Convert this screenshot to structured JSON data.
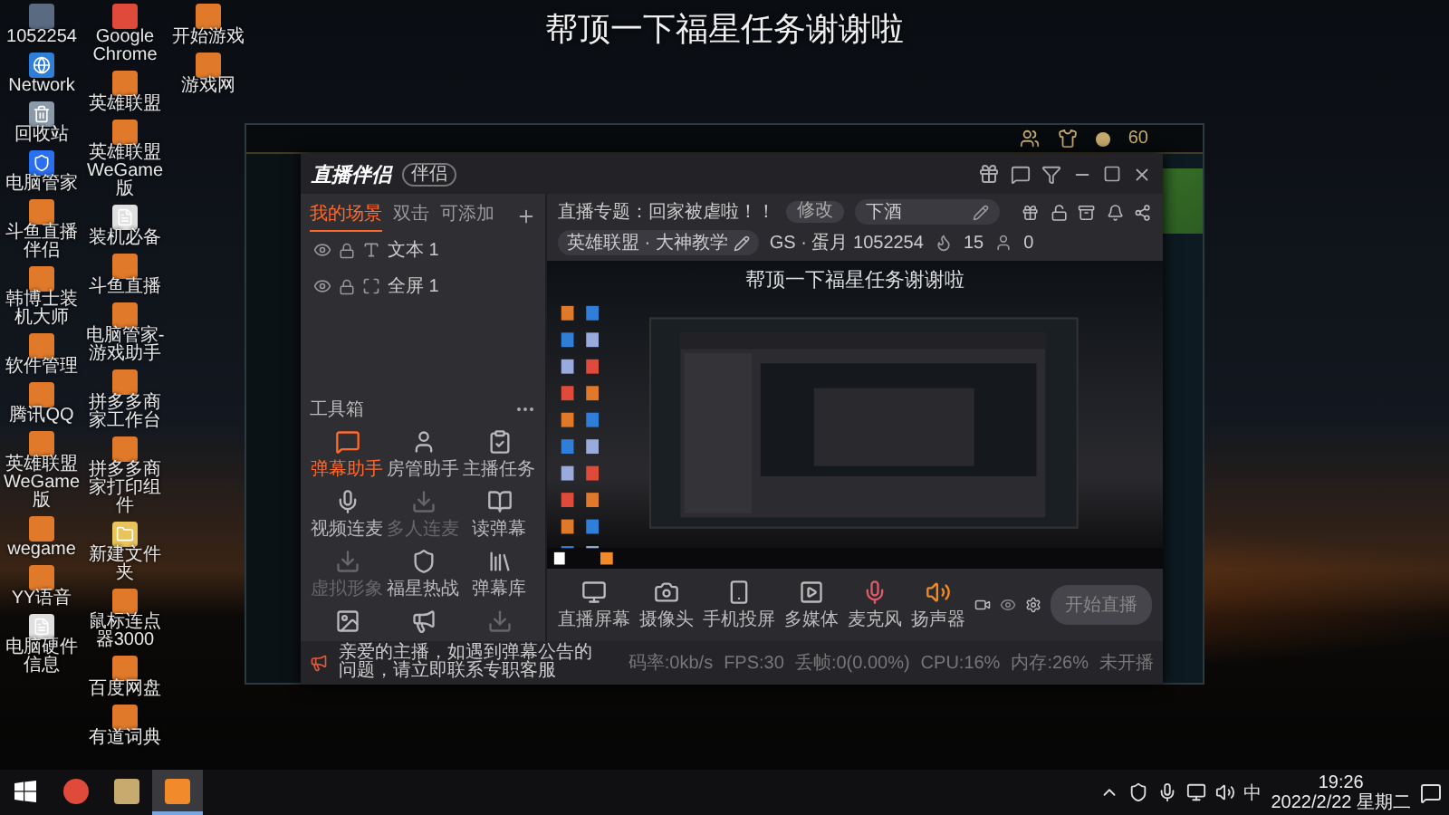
{
  "overlay_title": "帮顶一下福星任务谢谢啦",
  "desktop_columns": [
    [
      {
        "label": "1052254",
        "kind": "logo"
      },
      {
        "label": "Network",
        "kind": "globe"
      },
      {
        "label": "回收站",
        "kind": "bin"
      },
      {
        "label": "电脑管家",
        "kind": "shield"
      },
      {
        "label": "斗鱼直播伴侣",
        "kind": "app"
      },
      {
        "label": "韩博士装机大师",
        "kind": "app"
      },
      {
        "label": "软件管理",
        "kind": "app"
      },
      {
        "label": "腾讯QQ",
        "kind": "app"
      },
      {
        "label": "英雄联盟WeGame版",
        "kind": "app"
      },
      {
        "label": "wegame",
        "kind": "app"
      },
      {
        "label": "YY语音",
        "kind": "app"
      },
      {
        "label": "电脑硬件信息",
        "kind": "file"
      }
    ],
    [
      {
        "label": "Google Chrome",
        "kind": "chrome"
      },
      {
        "label": "英雄联盟",
        "kind": "app"
      },
      {
        "label": "英雄联盟WeGame版",
        "kind": "app"
      },
      {
        "label": "装机必备",
        "kind": "file"
      },
      {
        "label": "斗鱼直播",
        "kind": "app"
      },
      {
        "label": "电脑管家-游戏助手",
        "kind": "app"
      },
      {
        "label": "拼多多商家工作台",
        "kind": "app"
      },
      {
        "label": "拼多多商家打印组件",
        "kind": "app"
      },
      {
        "label": "新建文件夹",
        "kind": "folder"
      },
      {
        "label": "鼠标连点器3000",
        "kind": "app"
      },
      {
        "label": "百度网盘",
        "kind": "app"
      },
      {
        "label": "有道词典",
        "kind": "app"
      }
    ],
    [
      {
        "label": "开始游戏",
        "kind": "app"
      },
      {
        "label": "游戏网",
        "kind": "app"
      }
    ]
  ],
  "game_client": {
    "currency": "60"
  },
  "app": {
    "brand": "直播伴侣",
    "badge": "伴侣",
    "scene_tabs": [
      {
        "label": "我的场景",
        "selected": true
      },
      {
        "label": "双击",
        "selected": false
      },
      {
        "label": "可添加",
        "selected": false
      }
    ],
    "scenes": [
      {
        "label": "文本 1",
        "kind": "text",
        "visible": true
      },
      {
        "label": "全屏 1",
        "kind": "screen",
        "visible": true
      }
    ],
    "toolbox_title": "工具箱",
    "tools": [
      {
        "label": "弹幕助手",
        "kind": "danmaku",
        "on": true,
        "disabled": false
      },
      {
        "label": "房管助手",
        "kind": "manager",
        "on": false,
        "disabled": false
      },
      {
        "label": "主播任务",
        "kind": "task",
        "on": false,
        "disabled": false
      },
      {
        "label": "视频连麦",
        "kind": "video-call",
        "on": false,
        "disabled": false
      },
      {
        "label": "多人连麦",
        "kind": "download",
        "on": false,
        "disabled": true
      },
      {
        "label": "读弹幕",
        "kind": "read",
        "on": false,
        "disabled": false
      },
      {
        "label": "虚拟形象",
        "kind": "download",
        "on": false,
        "disabled": true
      },
      {
        "label": "福星热战",
        "kind": "fortune",
        "on": false,
        "disabled": false
      },
      {
        "label": "弹幕库",
        "kind": "library",
        "on": false,
        "disabled": false
      }
    ],
    "stream_title": "直播专题：回家被虐啦！！",
    "edit_button": "修改",
    "tag_field": "下酒",
    "category": "英雄联盟 · 大神教学",
    "room": "GS · 蛋月  1052254",
    "fans": "15",
    "viewers": "0",
    "preview_caption": "帮顶一下福星任务谢谢啦",
    "sources": [
      {
        "label": "直播屏幕",
        "kind": "screen"
      },
      {
        "label": "摄像头",
        "kind": "camera"
      },
      {
        "label": "手机投屏",
        "kind": "phone"
      },
      {
        "label": "多媒体",
        "kind": "media"
      },
      {
        "label": "麦克风",
        "kind": "mic"
      },
      {
        "label": "扬声器",
        "kind": "speaker"
      }
    ],
    "start_button": "开始直播",
    "notice": "亲爱的主播，如遇到弹幕公告的问题，请立即联系专职客服",
    "stats": [
      "码率:0kb/s",
      "FPS:30",
      "丢帧:0(0.00%)",
      "CPU:16%",
      "内存:26%",
      "未开播"
    ]
  },
  "taskbar": {
    "apps": [
      {
        "kind": "chrome",
        "selected": false
      },
      {
        "kind": "game",
        "selected": false
      },
      {
        "kind": "stream",
        "selected": true
      }
    ],
    "ime": "中",
    "time": "19:26",
    "date": "2022/2/22 星期二"
  }
}
